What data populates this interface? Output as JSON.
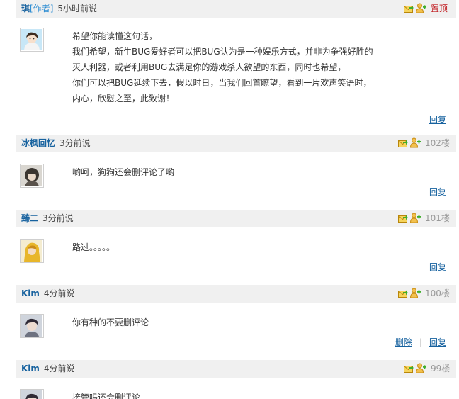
{
  "comments": [
    {
      "author": "琪",
      "author_tag": "[作者]",
      "time": "5小时前说",
      "pin_label": "置顶",
      "lines": [
        "希望你能读懂这句话，",
        " 我们希望，新生BUG爱好者可以把BUG认为是一种娱乐方式，并非为争强好胜的",
        "灭人利器，或者利用BUG去满足你的游戏杀人欲望的东西，同时也希望，",
        "你们可以把BUG延续下去，假以时日，当我们回首瞭望，看到一片欢声笑语时，",
        "内心，欣慰之至，此致谢！"
      ],
      "reply_label": "回复"
    },
    {
      "author": "冰枫回忆",
      "time": "3分前说",
      "floor": "102楼",
      "lines": [
        "哟呵，狗狗还会删评论了哟"
      ],
      "reply_label": "回复"
    },
    {
      "author": "臻二",
      "time": "3分前说",
      "floor": "101楼",
      "lines": [
        "路过。。。。。"
      ],
      "reply_label": "回复"
    },
    {
      "author": "Kim",
      "time": "4分前说",
      "floor": "100楼",
      "lines": [
        "你有种的不要删评论"
      ],
      "delete_label": "删除",
      "separator": "|",
      "reply_label": "回复"
    },
    {
      "author": "Kim",
      "time": "4分前说",
      "floor": "99楼",
      "lines": [
        "接管吗还会删评论"
      ]
    }
  ],
  "icons": {
    "forward": "envelope-forward-icon",
    "follow": "add-user-icon"
  },
  "colors": {
    "author": "#17629f",
    "author_tag": "#2a8bd2",
    "pin": "#c0171c",
    "floor": "#999999",
    "header_bg": "#f0f0f0",
    "link": "#17629f"
  }
}
